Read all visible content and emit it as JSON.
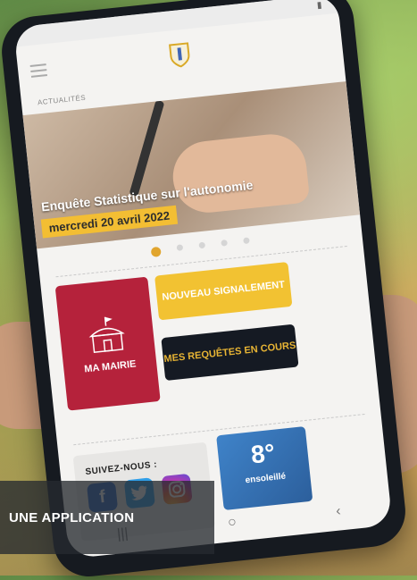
{
  "app": {
    "breadcrumb": "ACTUALITÉS",
    "slide": {
      "caption": "Enquête Statistique sur l'autonomie",
      "date": "mercredi 20 avril 2022",
      "dots_total": 5,
      "dots_active": 0
    },
    "tiles": {
      "mairie_label": "MA MAIRIE",
      "signalement_label": "NOUVEAU SIGNALEMENT",
      "requetes_label": "MES REQUÊTES EN COURS"
    },
    "social": {
      "title": "SUIVEZ-NOUS :",
      "icons": [
        "facebook-icon",
        "twitter-icon",
        "instagram-icon"
      ]
    },
    "weather": {
      "temperature": "8°",
      "description": "ensoleillé"
    },
    "navbar": {
      "recent": "|||",
      "home": "○",
      "back": "‹"
    }
  },
  "overlay": {
    "caption": "UNE APPLICATION"
  },
  "colors": {
    "brand_red": "#b5223b",
    "brand_yellow": "#f2c232",
    "dark": "#151a23"
  }
}
